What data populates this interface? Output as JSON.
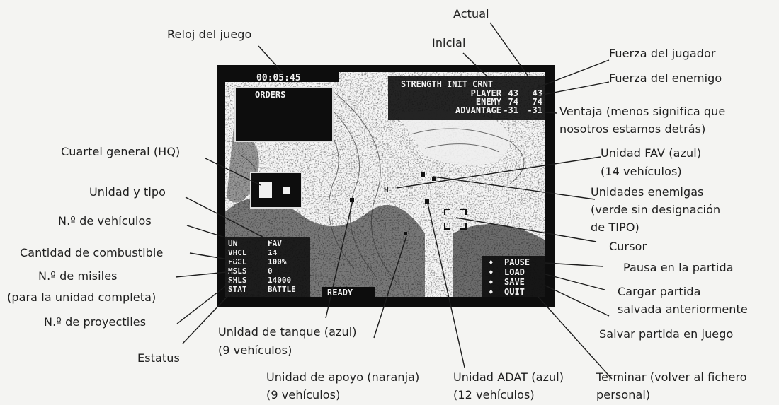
{
  "labels": {
    "reloj": "Reloj del juego",
    "actual": "Actual",
    "inicial": "Inicial",
    "fuerza_jugador": "Fuerza del jugador",
    "fuerza_enemigo": "Fuerza del enemigo",
    "ventaja_1": "Ventaja (menos significa que",
    "ventaja_2": "nosotros estamos detrás)",
    "cuartel": "Cuartel general (HQ)",
    "unidad_fav_1": "Unidad FAV (azul)",
    "unidad_fav_2": "(14 vehículos)",
    "unidad_tipo": "Unidad y tipo",
    "enemigas_1": "Unidades enemigas",
    "enemigas_2": "(verde sin designación",
    "enemigas_3": "de TIPO)",
    "vehiculos": "N.º de vehículos",
    "cursor": "Cursor",
    "combustible": "Cantidad de combustible",
    "pausa": "Pausa en la partida",
    "misiles_1": "N.º de misiles",
    "misiles_2": "(para la unidad completa)",
    "cargar_1": "Cargar partida",
    "cargar_2": "salvada anteriormente",
    "proyectiles": "N.º de proyectiles",
    "tanque_1": "Unidad de tanque (azul)",
    "tanque_2": "(9 vehículos)",
    "salvar": "Salvar partida en juego",
    "estatus": "Estatus",
    "apoyo_1": "Unidad de apoyo (naranja)",
    "apoyo_2": "(9 vehículos)",
    "adat_1": "Unidad ADAT (azul)",
    "adat_2": "(12 vehículos)",
    "terminar_1": "Terminar (volver al fichero",
    "terminar_2": "personal)"
  },
  "screen": {
    "clock": "00:05:45",
    "orders": "ORDERS",
    "ready": "READY",
    "strength_header": "STRENGTH INIT CRNT",
    "rows": [
      {
        "name": "PLAYER",
        "init": "43",
        "crnt": "43"
      },
      {
        "name": "ENEMY",
        "init": "74",
        "crnt": "74"
      },
      {
        "name": "ADVANTAGE",
        "init": "-31",
        "crnt": "-31"
      }
    ],
    "unit_stats": [
      {
        "key": "UN",
        "val": "FAV"
      },
      {
        "key": "VHCL",
        "val": "14"
      },
      {
        "key": "FUEL",
        "val": "100%"
      },
      {
        "key": "MSLS",
        "val": "0"
      },
      {
        "key": "SHLS",
        "val": "14000"
      },
      {
        "key": "STAT",
        "val": "BATTLE"
      }
    ],
    "menu": [
      "PAUSE",
      "LOAD",
      "SAVE",
      "QUIT"
    ]
  }
}
